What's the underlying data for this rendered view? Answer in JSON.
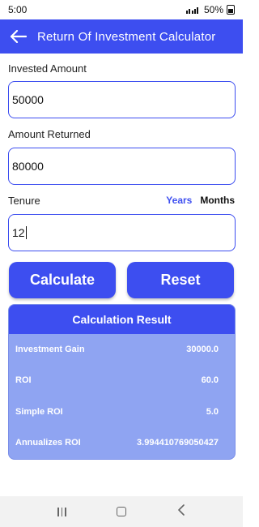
{
  "status_bar": {
    "time": "5:00",
    "battery": "50%"
  },
  "app_bar": {
    "title": "Return Of Investment Calculator"
  },
  "form": {
    "invested_label": "Invested Amount",
    "invested_value": "50000",
    "returned_label": "Amount Returned",
    "returned_value": "80000",
    "tenure_label": "Tenure",
    "tenure_value": "12",
    "tenure_options": [
      "Years",
      "Months"
    ],
    "tenure_selected": "Years"
  },
  "buttons": {
    "calculate": "Calculate",
    "reset": "Reset"
  },
  "result": {
    "header": "Calculation Result",
    "rows": [
      {
        "label": "Investment Gain",
        "value": "30000.0"
      },
      {
        "label": "ROI",
        "value": "60.0"
      },
      {
        "label": "Simple ROI",
        "value": "5.0"
      },
      {
        "label": "Annualizes ROI",
        "value": "3.994410769050427"
      }
    ]
  },
  "colors": {
    "primary": "#3d4ef0",
    "card": "#8fa4f2"
  },
  "icons": {
    "back": "arrow-left-icon",
    "signal": "signal-icon",
    "battery": "battery-icon"
  }
}
